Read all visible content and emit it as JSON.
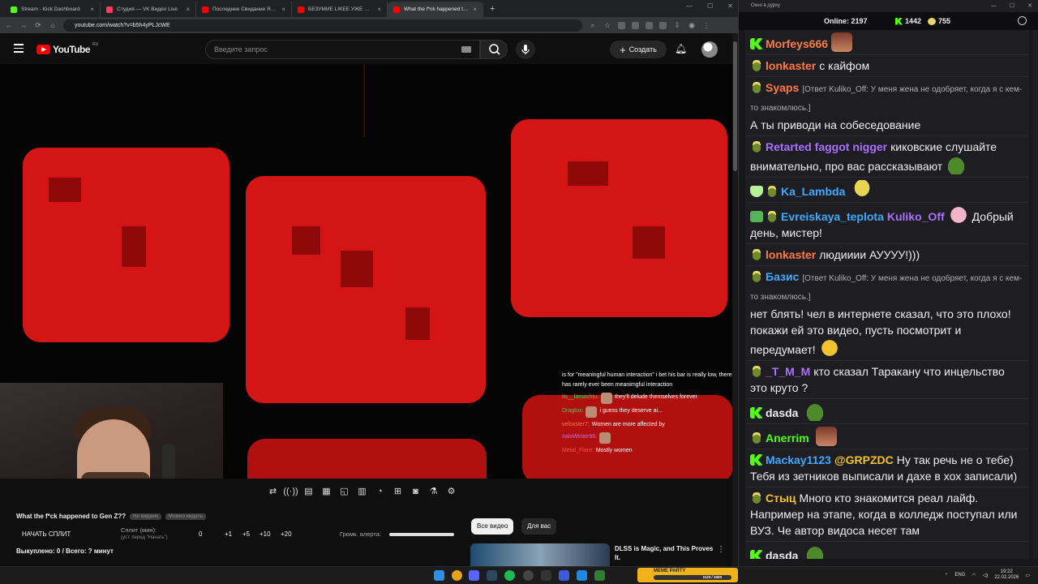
{
  "browser": {
    "tabs": [
      {
        "title": "Stream - Kick Dashboard",
        "color": "#53fc18"
      },
      {
        "title": "Студия — VK Видео Live",
        "color": "#ff3a5c"
      },
      {
        "title": "Последнее Свидание ЯйцесяIlfff",
        "color": "#ff0000"
      },
      {
        "title": "БЕЗУМИЕ LIKEE УЖЕ НЕ ОСТАНОВИТЬ",
        "color": "#ff0000"
      },
      {
        "title": "What the f*ck happened to Gen Z",
        "color": "#ff0000",
        "active": true
      }
    ],
    "newtab": "+",
    "url": "youtube.com/watch?v=b5h4yPLJcWE"
  },
  "youtube": {
    "logo_text": "YouTube",
    "region": "RU",
    "search_placeholder": "Введите запрос",
    "create_label": "Создать",
    "video_title": "What the f*ck happened to Gen Z??",
    "pill1": "Не кидаем",
    "pill2": "Можно кидать",
    "split_button": "НАЧАТЬ СПЛИТ",
    "split_label": "Сплит (мин):",
    "split_sub": "(уст. перед \"Начать\")",
    "split_value": "0",
    "increments": [
      "+1",
      "+5",
      "+10",
      "+20"
    ],
    "alert_label": "Громк. алерта:",
    "bought": "Выкуплено: 0 / Всего: ? минут",
    "chip_all": "Все видео",
    "chip_for_you": "Для вас",
    "rec_title": "DLSS is Magic, and This Proves It.",
    "alert_volume": 1.0
  },
  "overlay_chat": [
    {
      "nick": "",
      "text": "is for \"meaningful human interaction\" i bet his bar is really low, there has rarely ever been meanimgful interaction",
      "nick_color": "#39d353"
    },
    {
      "nick": "its__lamashtu:",
      "text": "they'll delude themselves forever",
      "nick_color": "#39d353"
    },
    {
      "nick": "Dragtox:",
      "text": "i guess they deserve ai...",
      "nick_color": "#39d353"
    },
    {
      "nick": "veloxster7:",
      "text": "Women are more affected by",
      "nick_color": "#ff7a45"
    },
    {
      "nick": "ItaloWinter96:",
      "text": "",
      "nick_color": "#a970ff"
    },
    {
      "nick": "Metal_Flare:",
      "text": "Mostly women",
      "nick_color": "#ff4d4d"
    }
  ],
  "chat": {
    "window_title": "Окно в дурку",
    "online_label": "Online:",
    "online_count": "2197",
    "kick_count": "1442",
    "pepe_count": "755",
    "messages": [
      {
        "badges": [
          "k"
        ],
        "user": "Morfeys666",
        "color": "#ff7a45",
        "text": "",
        "emote_after_user": "face"
      },
      {
        "badges": [
          "pepe"
        ],
        "user": "lonkaster",
        "color": "#ff7a45",
        "text": "с кайфом"
      },
      {
        "badges": [
          "pepe"
        ],
        "user": "Syaps",
        "color": "#ff7a45",
        "reply": "[Ответ Kuliko_Off: У меня жена не одобряет, когда я с кем-то знакомлюсь.]",
        "text": "А ты приводи на собеседование"
      },
      {
        "badges": [
          "pepe"
        ],
        "user": "Retarted faggot nigger",
        "color": "#a970ff",
        "text": "киковские слушайте внимательно, про вас рассказывают",
        "emote_end": "frog"
      },
      {
        "badges": [
          "shield",
          "pepe"
        ],
        "user": "Ka_Lambda",
        "color": "#3fa9ff",
        "text": "",
        "emote_end": "pepeY"
      },
      {
        "badges": [
          "brush",
          "pepe"
        ],
        "user": "Evreiskaya_teplota",
        "color": "#3fa9ff",
        "text": "Добрый день, мистер!",
        "mention": "Kuliko_Off",
        "mention_color": "#a970ff",
        "emote_mid": "pink"
      },
      {
        "badges": [
          "pepe"
        ],
        "user": "lonkaster",
        "color": "#ff7a45",
        "text": "людииии АУУУУ!)))"
      },
      {
        "badges": [
          "pepe"
        ],
        "user": "Базис",
        "color": "#3fa9ff",
        "reply": "[Ответ Kuliko_Off: У меня жена не одобряет, когда я с кем-то знакомлюсь.]",
        "text": "нет блять! чел в интернете сказал, что это плохо! покажи ей это видео, пусть посмотрит и передумает!",
        "emote_end": "laugh"
      },
      {
        "badges": [
          "pepe"
        ],
        "user": "_T_M_M",
        "color": "#a970ff",
        "text": "кто сказал Таракану что инцельство это круто ?"
      },
      {
        "badges": [
          "k"
        ],
        "user": "dasda",
        "color": "#efeff1",
        "text": "",
        "emote_end": "frog"
      },
      {
        "badges": [
          "pepe"
        ],
        "user": "Anerrim",
        "color": "#53fc18",
        "text": "",
        "emote_end": "face"
      },
      {
        "badges": [
          "k"
        ],
        "user": "Mackay1123",
        "color": "#3fa9ff",
        "text": "Ну так речь не о тебе) Тебя из зетников выписали и дахе в хох записали)",
        "mention": "@GRPZDC",
        "mention_color": "#f2c230"
      },
      {
        "badges": [
          "pepe"
        ],
        "user": "Стыц",
        "color": "#f2c230",
        "text": "Много кто знакомится реал лайф. Например на этапе, когда в колледж поступал или ВУЗ. Че автор видоса несет там"
      },
      {
        "badges": [
          "k"
        ],
        "user": "dasda",
        "color": "#efeff1",
        "text": "",
        "emote_end": "frog"
      }
    ]
  },
  "taskbar": {
    "meme_title": "MEME PARTY",
    "meme_progress": "1123 / 1500",
    "meme_fill": 0.75,
    "lang": "ENG",
    "time": "19:22",
    "date": "22.02.2026"
  }
}
